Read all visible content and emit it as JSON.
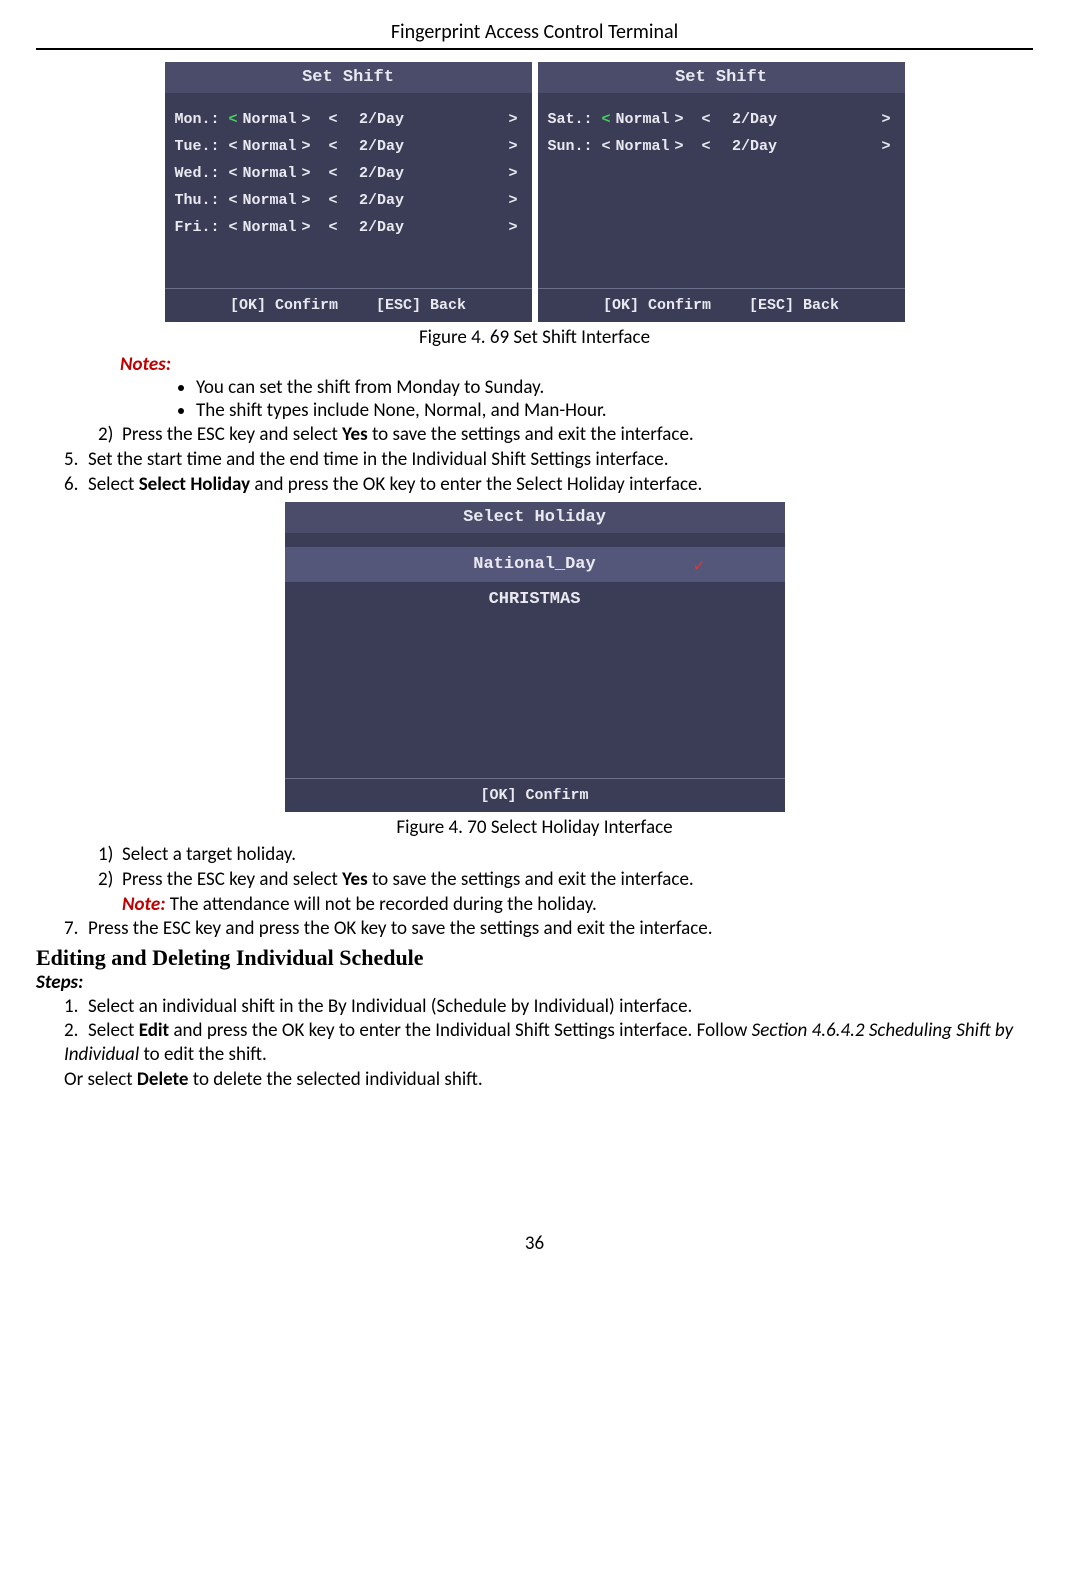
{
  "header": "Fingerprint Access Control Terminal",
  "figure1": {
    "panelTitle": "Set Shift",
    "left": [
      {
        "day": "Mon.:",
        "v1": "Normal",
        "v2": "2/Day",
        "hl": true
      },
      {
        "day": "Tue.:",
        "v1": "Normal",
        "v2": "2/Day",
        "hl": false
      },
      {
        "day": "Wed.:",
        "v1": "Normal",
        "v2": "2/Day",
        "hl": false
      },
      {
        "day": "Thu.:",
        "v1": "Normal",
        "v2": "2/Day",
        "hl": false
      },
      {
        "day": "Fri.:",
        "v1": "Normal",
        "v2": "2/Day",
        "hl": false
      }
    ],
    "right": [
      {
        "day": "Sat.:",
        "v1": "Normal",
        "v2": "2/Day",
        "hl": true
      },
      {
        "day": "Sun.:",
        "v1": "Normal",
        "v2": "2/Day",
        "hl": false
      }
    ],
    "footerConfirm": "[OK] Confirm",
    "footerBack": "[ESC] Back",
    "caption": "Figure 4. 69 Set Shift Interface"
  },
  "notesLabel": "Notes:",
  "noteLabel": "Note:",
  "notes": [
    "You can set the shift from Monday to Sunday.",
    "The shift types include None, Normal, and Man-Hour."
  ],
  "step2a": "Press the ESC key and select ",
  "step2b": "Yes",
  "step2c": " to save the settings and exit the interface.",
  "step5": "Set the start time and the end time in the Individual Shift Settings interface.",
  "step6a": "Select ",
  "step6b": "Select Holiday",
  "step6c": " and press the OK key to enter the Select Holiday interface.",
  "figure2": {
    "title": "Select Holiday",
    "items": [
      {
        "label": "National_Day",
        "selected": true
      },
      {
        "label": "CHRISTMAS",
        "selected": false
      }
    ],
    "footer": "[OK] Confirm",
    "caption": "Figure 4. 70 Select Holiday Interface"
  },
  "sub1": "Select a target holiday.",
  "sub2a": "Press the ESC key and select ",
  "sub2b": "Yes",
  "sub2c": " to save the settings and exit the interface.",
  "sub2note": " The attendance will not be recorded during the holiday.",
  "step7": "Press the ESC key and press the OK key to save the settings and exit the interface.",
  "section2": "Editing and Deleting Individual Schedule",
  "stepsLabel": "Steps:",
  "edit1": "Select an individual shift in the By Individual (Schedule by Individual) interface.",
  "edit2a": "Select ",
  "edit2b": "Edit",
  "edit2c": " and press the OK key to enter the Individual Shift Settings interface. Follow ",
  "edit2d": "Section 4.6.4.2 Scheduling Shift by Individual",
  "edit2e": " to edit the shift.",
  "edit2f": "Or select ",
  "edit2g": "Delete",
  "edit2h": " to delete the selected individual shift.",
  "pageNumber": "36"
}
